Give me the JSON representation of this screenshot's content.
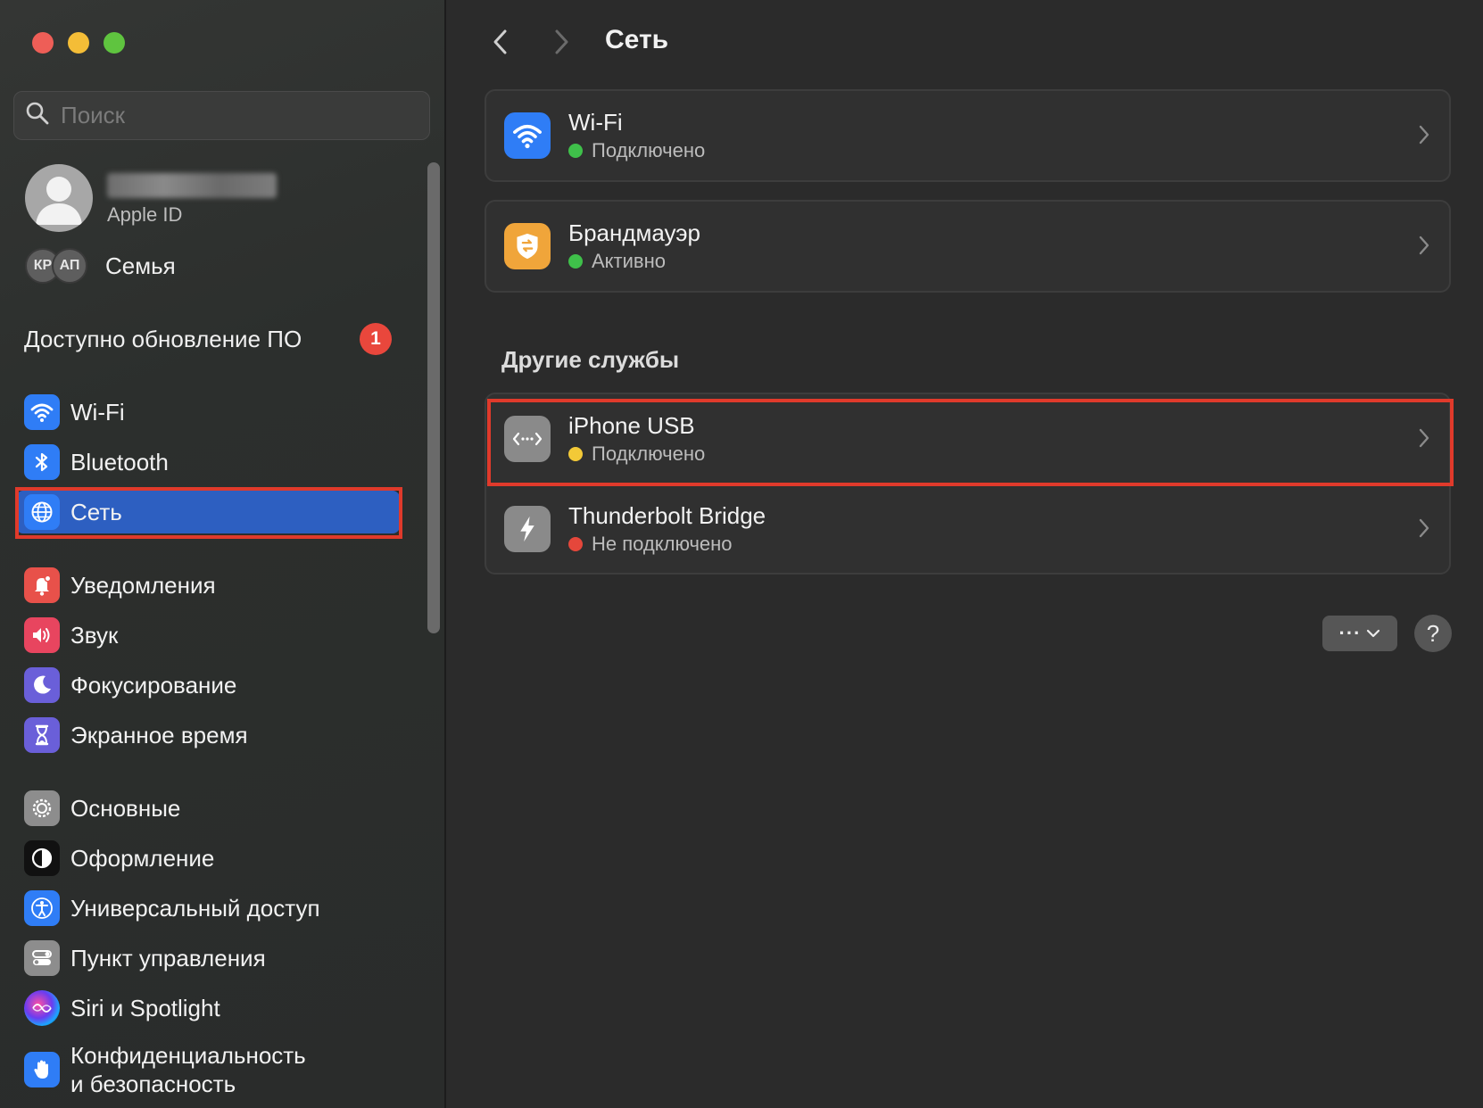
{
  "window": {
    "title": "Сеть"
  },
  "sidebar": {
    "search_placeholder": "Поиск",
    "account": {
      "subtitle": "Apple ID"
    },
    "family": {
      "members": [
        "КР",
        "АП"
      ],
      "label": "Семья"
    },
    "update": {
      "label": "Доступно обновление ПО",
      "badge": "1"
    },
    "items": [
      {
        "label": "Wi-Fi",
        "icon": "wifi-icon",
        "color": "#2f7df6"
      },
      {
        "label": "Bluetooth",
        "icon": "bluetooth-icon",
        "color": "#2f7df6"
      },
      {
        "label": "Сеть",
        "icon": "globe-icon",
        "color": "#2f7df6",
        "selected": true
      },
      {
        "label": "Уведомления",
        "icon": "bell-icon",
        "color": "#e8514a"
      },
      {
        "label": "Звук",
        "icon": "speaker-icon",
        "color": "#e8455f"
      },
      {
        "label": "Фокусирование",
        "icon": "moon-icon",
        "color": "#6a5fd9"
      },
      {
        "label": "Экранное время",
        "icon": "hourglass-icon",
        "color": "#6a5fd9"
      },
      {
        "label": "Основные",
        "icon": "gear-icon",
        "color": "#8d8d8d"
      },
      {
        "label": "Оформление",
        "icon": "appearance-icon",
        "color": "#111111"
      },
      {
        "label": "Универсальный доступ",
        "icon": "accessibility-icon",
        "color": "#2f7df6"
      },
      {
        "label": "Пункт управления",
        "icon": "control-center-icon",
        "color": "#8d8d8d"
      },
      {
        "label": "Siri и Spotlight",
        "icon": "siri-icon",
        "color": "#222222"
      },
      {
        "label": "Конфиденциальность\nи безопасность",
        "label_line1": "Конфиденциальность",
        "label_line2": "и безопасность",
        "icon": "hand-icon",
        "color": "#2f7df6"
      }
    ]
  },
  "main": {
    "title": "Сеть",
    "services": [
      {
        "name": "Wi-Fi",
        "status": "Подключено",
        "status_color": "#3fc04a",
        "icon": "wifi-icon",
        "icon_color": "#2f7df6"
      },
      {
        "name": "Брандмауэр",
        "status": "Активно",
        "status_color": "#3fc04a",
        "icon": "firewall-icon",
        "icon_color": "#f0a53a"
      }
    ],
    "other_label": "Другие службы",
    "other_services": [
      {
        "name": "iPhone USB",
        "status": "Подключено",
        "status_color": "#f3c937",
        "icon": "usb-network-icon",
        "icon_color": "#8a8a8a"
      },
      {
        "name": "Thunderbolt Bridge",
        "status": "Не подключено",
        "status_color": "#e5473b",
        "icon": "thunderbolt-icon",
        "icon_color": "#8a8a8a"
      }
    ],
    "more_label": "···",
    "help_label": "?"
  }
}
